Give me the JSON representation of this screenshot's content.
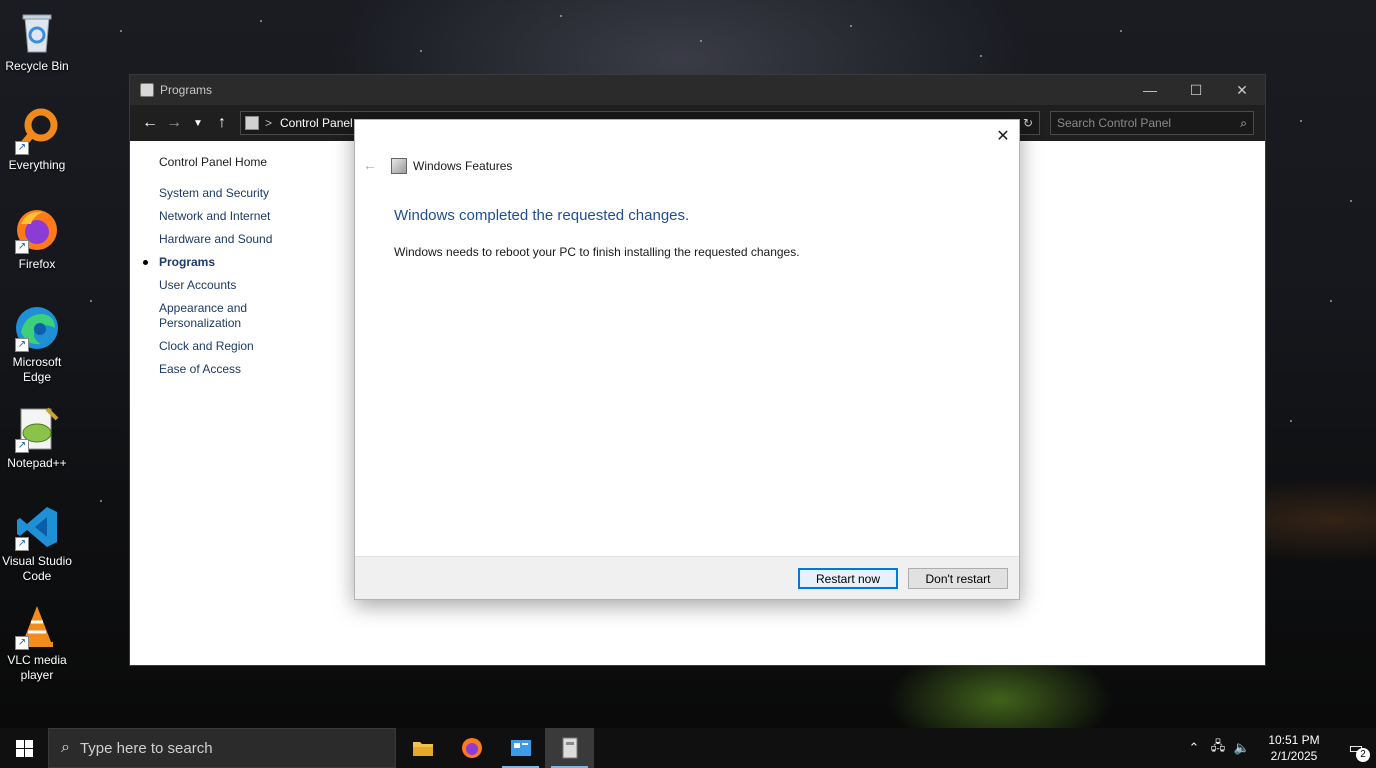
{
  "desktop": {
    "icons": [
      {
        "label": "Recycle Bin",
        "icon": "recycle-bin-icon"
      },
      {
        "label": "Everything",
        "icon": "everything-search-icon"
      },
      {
        "label": "Firefox",
        "icon": "firefox-icon"
      },
      {
        "label": "Microsoft Edge",
        "icon": "edge-icon"
      },
      {
        "label": "Notepad++",
        "icon": "notepad-plus-plus-icon"
      },
      {
        "label": "Visual Studio Code",
        "icon": "vscode-icon"
      },
      {
        "label": "VLC media player",
        "icon": "vlc-icon"
      }
    ]
  },
  "control_panel": {
    "title": "Programs",
    "address": {
      "crumb": "Control Panel",
      "separator": ">",
      "next": ">"
    },
    "search_placeholder": "Search Control Panel",
    "sidebar": {
      "home": "Control Panel Home",
      "items": [
        {
          "label": "System and Security",
          "active": false
        },
        {
          "label": "Network and Internet",
          "active": false
        },
        {
          "label": "Hardware and Sound",
          "active": false
        },
        {
          "label": "Programs",
          "active": true
        },
        {
          "label": "User Accounts",
          "active": false
        },
        {
          "label": "Appearance and Personalization",
          "active": false
        },
        {
          "label": "Clock and Region",
          "active": false
        },
        {
          "label": "Ease of Access",
          "active": false
        }
      ]
    }
  },
  "dialog": {
    "title": "Windows Features",
    "heading": "Windows completed the requested changes.",
    "message": "Windows needs to reboot your PC to finish installing the requested changes.",
    "buttons": {
      "restart": "Restart now",
      "dont_restart": "Don't restart"
    },
    "accent_color": "#1f4e95"
  },
  "taskbar": {
    "search_placeholder": "Type here to search",
    "apps": [
      "file-explorer-icon",
      "firefox-icon",
      "control-panel-icon",
      "windows-features-icon"
    ],
    "clock": {
      "time": "10:51 PM",
      "date": "2/1/2025"
    },
    "notification_count": "2"
  }
}
